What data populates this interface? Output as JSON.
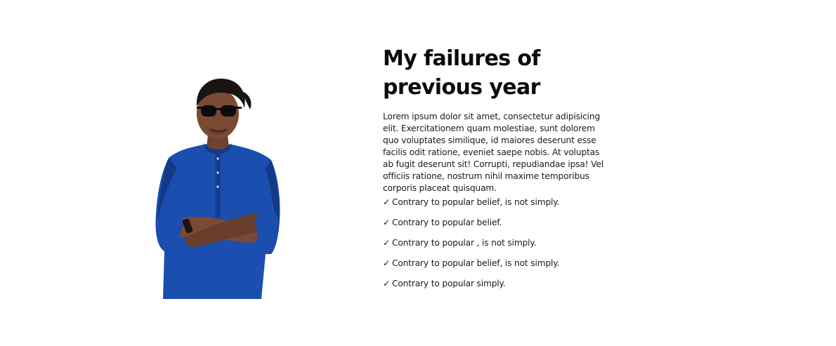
{
  "section": {
    "title": "My failures of previous year",
    "description": "Lorem ipsum dolor sit amet, consectetur adipisicing elit. Exercitationem quam molestiae, sunt dolorem quo voluptates similique, id maiores deserunt esse facilis odit ratione, eveniet saepe nobis. At voluptas ab fugit deserunt sit! Corrupti, repudiandae ipsa! Vel officiis ratione, nostrum nihil maxime temporibus corporis placeat quisquam.",
    "check_symbol": "✓",
    "checklist": [
      "Contrary to popular belief, is not simply.",
      "Contrary to popular belief.",
      "Contrary to popular , is not simply.",
      "Contrary to popular belief, is not simply.",
      "Contrary to popular simply."
    ]
  },
  "colors": {
    "shirt": "#1a4fb0",
    "shirt_dark": "#123a86",
    "skin": "#7a4a35",
    "hair": "#1a1412",
    "glasses": "#0c0c0c"
  }
}
